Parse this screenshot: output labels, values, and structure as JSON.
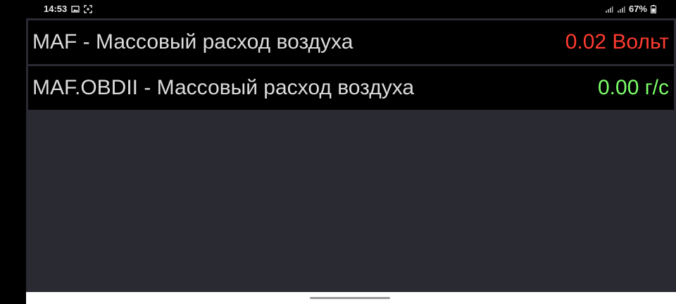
{
  "status_bar": {
    "time": "14:53",
    "battery": "67%",
    "icons_left": [
      "image-icon",
      "screenshot-icon"
    ],
    "icons_right": [
      "signal-icon",
      "signal-icon",
      "battery-icon"
    ]
  },
  "sensors": [
    {
      "label": "MAF - Массовый расход воздуха",
      "value": "0.02 Вольт",
      "value_color": "#ff3b30"
    },
    {
      "label": "MAF.OBDII - Массовый расход воздуха",
      "value": "0.00 г/с",
      "value_color": "#7dff6a"
    }
  ],
  "colors": {
    "background": "#2a2a33",
    "row_background": "#000000",
    "label": "#dcdcdc"
  }
}
